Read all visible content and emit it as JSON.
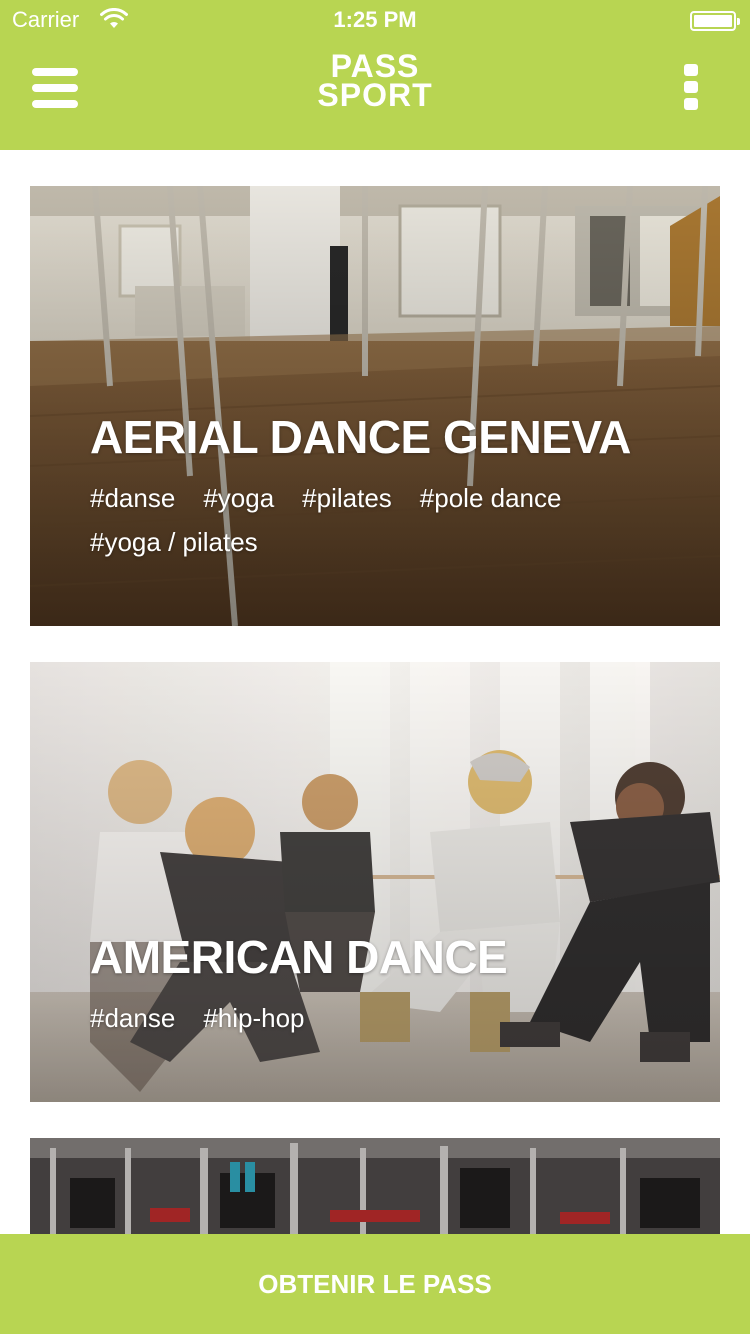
{
  "status_bar": {
    "carrier": "Carrier",
    "time": "1:25 PM"
  },
  "header": {
    "logo_line1": "PASS",
    "logo_line2": "SPORT",
    "background_color": "#b8d552",
    "left_icon": "hamburger-menu-icon",
    "right_icon": "more-vertical-icon"
  },
  "cards": [
    {
      "title": "AERIAL DANCE GENEVA",
      "tags": [
        "#danse",
        "#yoga",
        "#pilates",
        "#pole dance",
        "#yoga / pilates"
      ]
    },
    {
      "title": "AMERICAN DANCE",
      "tags": [
        "#danse",
        "#hip-hop"
      ]
    },
    {
      "title": "",
      "tags": []
    }
  ],
  "cta": {
    "label": "OBTENIR LE PASS"
  }
}
